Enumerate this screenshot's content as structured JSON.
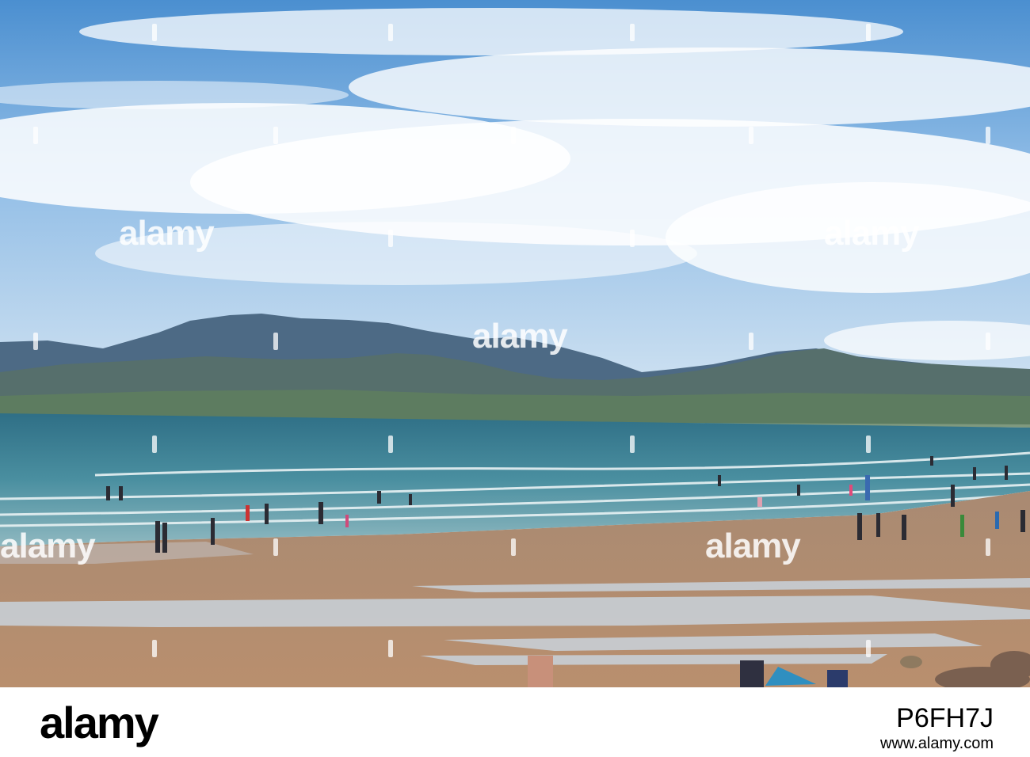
{
  "watermark": {
    "text": "alamy"
  },
  "footer": {
    "logo": "alamy",
    "image_id": "P6FH7J",
    "url": "www.alamy.com"
  }
}
